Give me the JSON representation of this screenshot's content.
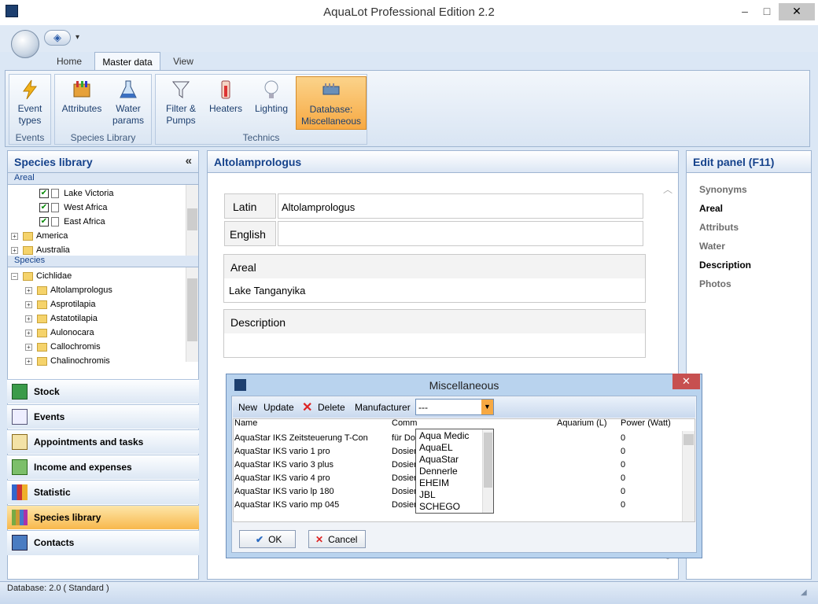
{
  "window": {
    "title": "AquaLot Professional Edition 2.2",
    "min": "–",
    "max": "□",
    "close": "✕"
  },
  "ribbon": {
    "tabs": [
      "Home",
      "Master data",
      "View"
    ],
    "groups": {
      "events": "Events",
      "species": "Species Library",
      "technics": "Technics"
    },
    "buttons": {
      "event_types": "Event types",
      "attributes": "Attributes",
      "water_params": "Water params",
      "filter_pumps": "Filter & Pumps",
      "heaters": "Heaters",
      "lighting": "Lighting",
      "db_misc": "Database: Miscellaneous"
    }
  },
  "left": {
    "title": "Species library",
    "collapse": "«",
    "areal_label": "Areal",
    "species_label": "Species",
    "areal_items": [
      "Lake Victoria",
      "West Africa",
      "East Africa",
      "America",
      "Australia"
    ],
    "species_root": "Cichlidae",
    "species_items": [
      "Altolamprologus",
      "Asprotilapia",
      "Astatotilapia",
      "Aulonocara",
      "Callochromis",
      "Chalinochromis"
    ],
    "nav": [
      "Stock",
      "Events",
      "Appointments and tasks",
      "Income and expenses",
      "Statistic",
      "Species library",
      "Contacts"
    ]
  },
  "center": {
    "title": "Altolamprologus",
    "latin_label": "Latin",
    "latin_value": "Altolamprologus",
    "english_label": "English",
    "english_value": "",
    "areal_label": "Areal",
    "areal_value": "Lake Tanganyika",
    "description_label": "Description"
  },
  "edit_panel": {
    "title": "Edit panel (F11)",
    "items": [
      "Synonyms",
      "Areal",
      "Attributs",
      "Water",
      "Description",
      "Photos"
    ]
  },
  "dialog": {
    "title": "Miscellaneous",
    "new": "New",
    "update": "Update",
    "delete": "Delete",
    "manufacturer_label": "Manufacturer",
    "manufacturer_value": "---",
    "columns": [
      "Name",
      "Comm",
      "Aquarium (L)",
      "Power (Watt)"
    ],
    "rows": [
      {
        "name": "AquaStar IKS Zeitsteuerung T-Con",
        "comm": "für Do",
        "power": "0"
      },
      {
        "name": "AquaStar IKS vario  1 pro",
        "comm": "Dosier",
        "power": "0"
      },
      {
        "name": "AquaStar IKS vario  3 plus",
        "comm": "Dosier",
        "power": "0"
      },
      {
        "name": "AquaStar IKS vario  4 pro",
        "comm": "Dosier",
        "power": "0"
      },
      {
        "name": "AquaStar IKS vario  lp 180",
        "comm": "Dosier",
        "power": "0"
      },
      {
        "name": "AquaStar IKS vario  mp 045",
        "comm": "Dosier",
        "power": "0"
      }
    ],
    "dropdown": [
      "Aqua Medic",
      "AquaEL",
      "AquaStar",
      "Dennerle",
      "EHEIM",
      "JBL",
      "SCHEGO"
    ],
    "ok": "OK",
    "cancel": "Cancel"
  },
  "status": {
    "text": "Database: 2.0 ( Standard )"
  }
}
